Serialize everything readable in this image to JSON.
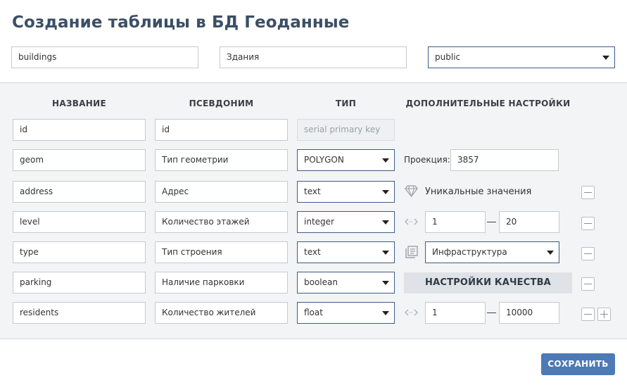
{
  "title": "Создание таблицы в БД Геоданные",
  "table": {
    "name": "buildings",
    "alias": "Здания",
    "schema": "public"
  },
  "headers": {
    "name": "НАЗВАНИЕ",
    "alias": "ПСЕВДОНИМ",
    "type": "ТИП",
    "extra": "ДОПОЛНИТЕЛЬНЫЕ НАСТРОЙКИ"
  },
  "rows": [
    {
      "name": "id",
      "alias": "id",
      "type": "serial primary key"
    },
    {
      "name": "geom",
      "alias": "Тип геометрии",
      "type": "POLYGON",
      "extra": {
        "label": "Проекция:",
        "value": "3857"
      }
    },
    {
      "name": "address",
      "alias": "Адрес",
      "type": "text",
      "extra": {
        "label": "Уникальные значения",
        "icon": "diamond-icon"
      }
    },
    {
      "name": "level",
      "alias": "Количество этажей",
      "type": "integer",
      "extra": {
        "icon": "range-arrows-icon",
        "min": "1",
        "max": "20"
      }
    },
    {
      "name": "type",
      "alias": "Тип строения",
      "type": "text",
      "extra": {
        "icon": "dictionary-icon",
        "value": "Инфраструктура"
      }
    },
    {
      "name": "parking",
      "alias": "Наличие парковки",
      "type": "boolean",
      "extra": {
        "button": "НАСТРОЙКИ КАЧЕСТВА"
      }
    },
    {
      "name": "residents",
      "alias": "Количество жителей",
      "type": "float",
      "extra": {
        "icon": "range-arrows-icon",
        "min": "1",
        "max": "10000"
      }
    }
  ],
  "save_label": "СОХРАНИТЬ",
  "colors": {
    "accent": "#4d7ab5",
    "title": "#3b4f66",
    "panel_bg": "#f3f4f6",
    "select_border": "#3d5c85"
  }
}
